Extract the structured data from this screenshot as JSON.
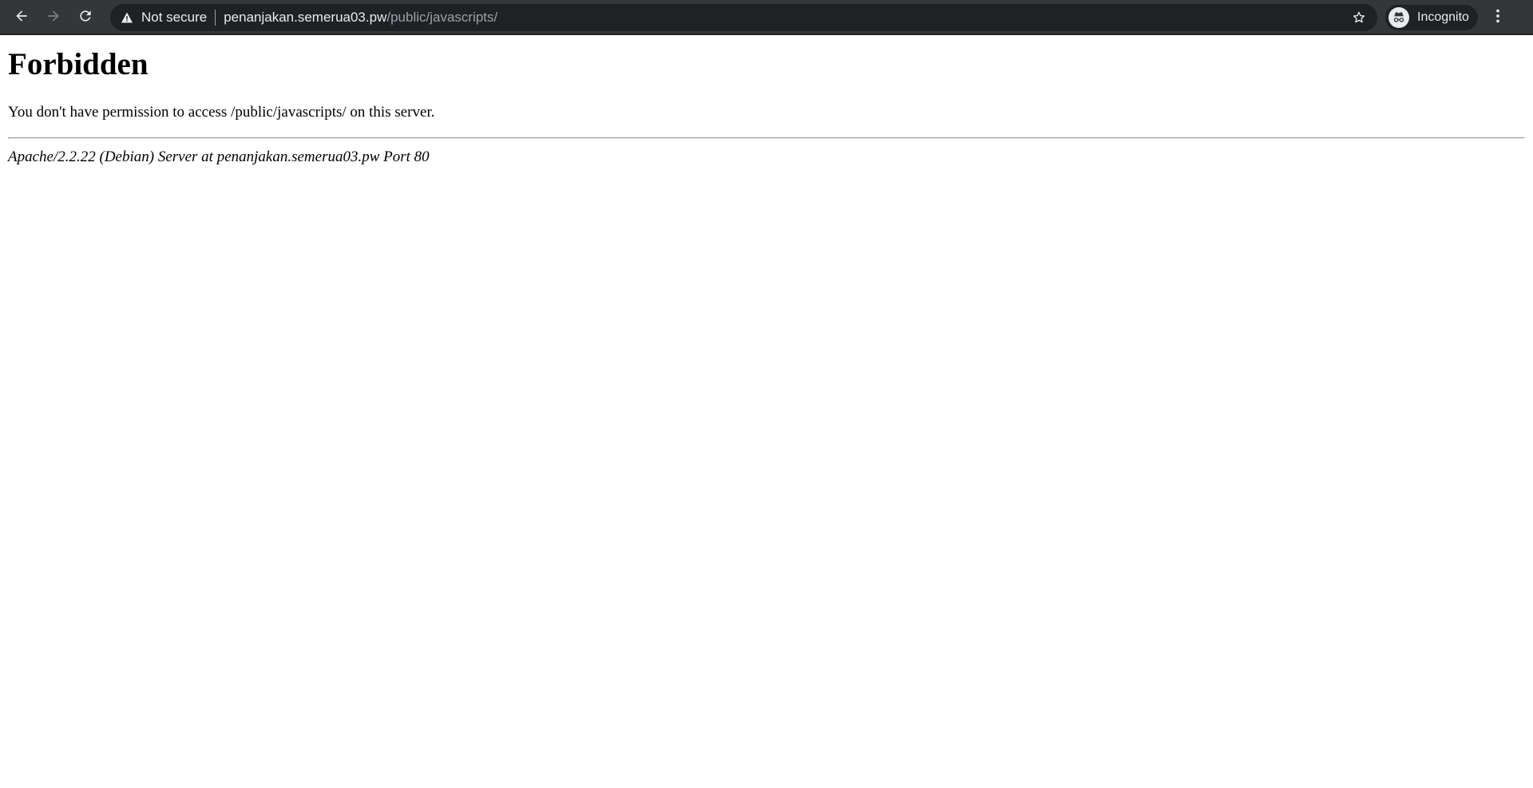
{
  "browser": {
    "back_icon": "arrow-left-icon",
    "forward_icon": "arrow-right-icon",
    "reload_icon": "reload-icon",
    "security_icon": "warning-triangle-icon",
    "security_label": "Not secure",
    "url_host": "penanjakan.semerua03.pw",
    "url_path": "/public/javascripts/",
    "bookmark_icon": "star-outline-icon",
    "profile_icon": "incognito-icon",
    "profile_label": "Incognito",
    "menu_icon": "kebab-menu-icon"
  },
  "page": {
    "heading": "Forbidden",
    "message": "You don't have permission to access /public/javascripts/ on this server.",
    "server_signature": "Apache/2.2.22 (Debian) Server at penanjakan.semerua03.pw Port 80"
  },
  "colors": {
    "toolbar_bg": "#35363a",
    "omnibox_bg": "#202124",
    "toolbar_text": "#e8eaed",
    "url_path_text": "#9aa0a6",
    "page_bg": "#ffffff"
  }
}
